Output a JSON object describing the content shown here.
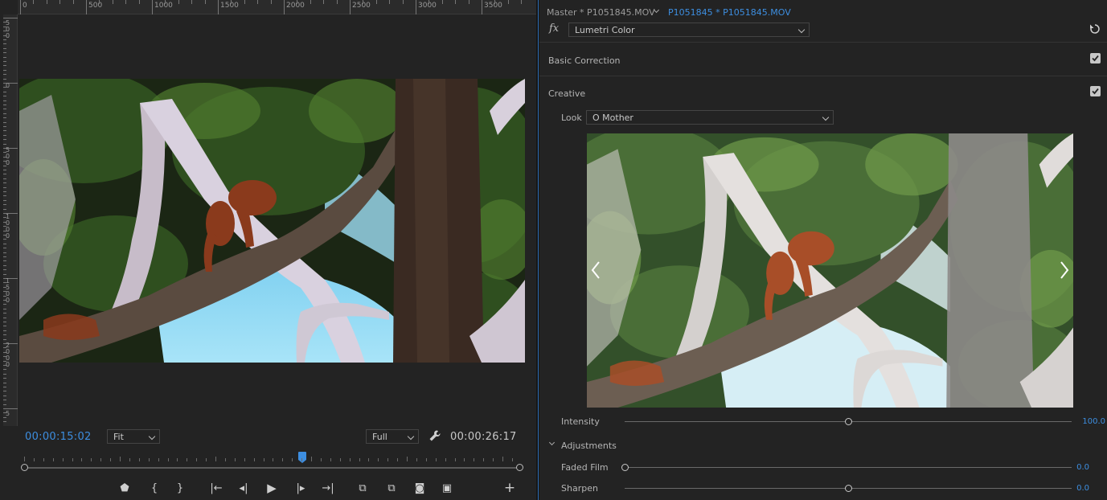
{
  "monitor": {
    "ruler_labels": [
      "0",
      "500",
      "1000",
      "1500",
      "2000",
      "2500",
      "3000",
      "3500"
    ],
    "vruler_labels": [
      "500",
      "0",
      "500",
      "1000",
      "1500",
      "2000",
      "5"
    ],
    "timecode_current": "00:00:15:02",
    "timecode_duration": "00:00:26:17",
    "zoom_select": "Fit",
    "resolution_select": "Full",
    "playhead_fraction": 0.56,
    "transport_icons": [
      "marker-icon",
      "mark-in-icon",
      "mark-out-icon",
      "go-to-in-icon",
      "step-back-icon",
      "play-icon",
      "step-forward-icon",
      "go-to-out-icon",
      "lift-icon",
      "extract-icon",
      "export-frame-icon",
      "comparison-view-icon",
      "add-button-icon"
    ],
    "transport_glyphs": [
      "⬟",
      "{",
      "}",
      "|←",
      "◂|",
      "▶",
      "|▸",
      "→|",
      "⧉",
      "⧉",
      "◙",
      "▣",
      "+"
    ]
  },
  "lumetri": {
    "tab_master": "Master * P1051845.MOV",
    "tab_clip": "P1051845 * P1051845.MOV",
    "fx_label": "fx",
    "effect_name": "Lumetri Color",
    "basic_correction": "Basic Correction",
    "creative": "Creative",
    "look_label": "Look",
    "look_value": "O Mother",
    "intensity_label": "Intensity",
    "intensity_value": "100.0",
    "intensity_fraction": 0.5,
    "adjustments_label": "Adjustments",
    "faded_film_label": "Faded Film",
    "faded_film_value": "0.0",
    "faded_film_fraction": 0.0,
    "sharpen_label": "Sharpen",
    "sharpen_value": "0.0",
    "sharpen_fraction": 0.5
  },
  "colors": {
    "accent": "#3d8ee0",
    "panel": "#232323",
    "sky": "#8fd6f0",
    "foliage": "#2b4a1e",
    "bark": "#c9c4c2",
    "orangutan": "#a34a22"
  }
}
